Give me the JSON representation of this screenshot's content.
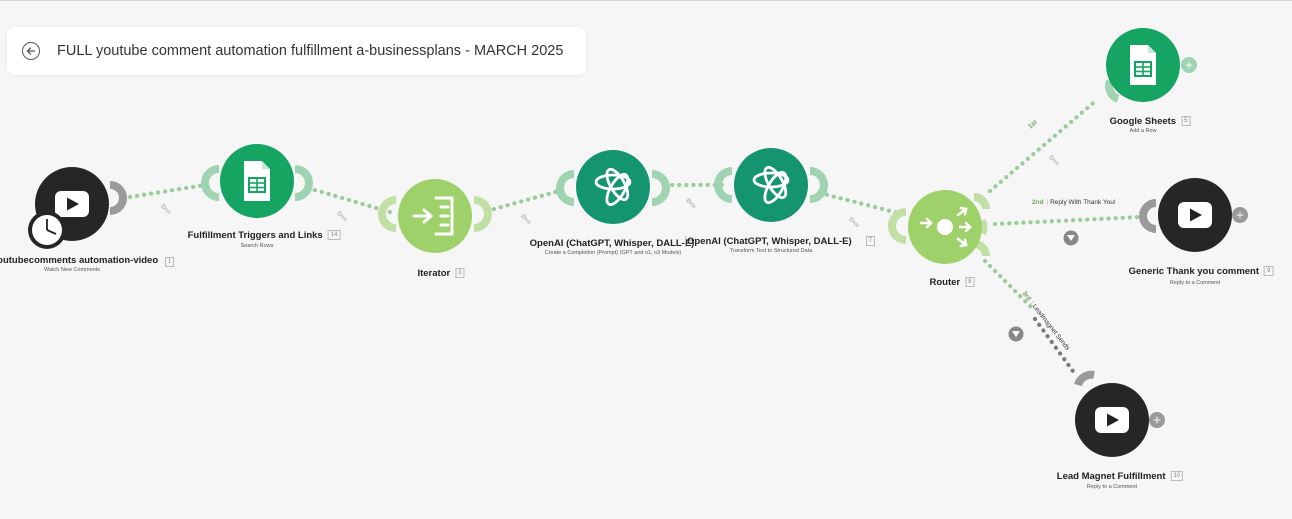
{
  "scenario": {
    "title": "FULL youtube comment automation fulfillment a-businessplans - MARCH 2025",
    "back_icon": "arrow-left-icon"
  },
  "colors": {
    "canvas_bg": "#f6f6f6",
    "youtube": "#262626",
    "sheets": "#15a462",
    "iterator": "#9ed16a",
    "openai": "#14946f",
    "router": "#9ed16a",
    "connector_green": "#98cc98",
    "connector_dark": "#7a7a7a",
    "route_number": "#6da35d"
  },
  "modules": [
    {
      "key": "yt_watch",
      "icon": "youtube-play-icon",
      "name": "youtubecomments automation-video",
      "id": "1",
      "subtitle": "Watch New Comments",
      "trigger_icon": "clock-icon"
    },
    {
      "key": "sheets_search",
      "icon": "google-sheets-icon",
      "name": "Fulfillment Triggers and Links",
      "id": "14",
      "subtitle": "Search Rows"
    },
    {
      "key": "iterator",
      "icon": "iterator-icon",
      "name": "Iterator",
      "id": "3",
      "subtitle": ""
    },
    {
      "key": "openai_1",
      "icon": "openai-icon",
      "name": "OpenAI (ChatGPT, Whisper, DALL-E)",
      "id": "",
      "subtitle": "Create a Completion (Prompt) (GPT and o1, o3 Models)"
    },
    {
      "key": "openai_2",
      "icon": "openai-icon",
      "name": "OpenAI (ChatGPT, Whisper, DALL-E)",
      "id": "7",
      "subtitle": "Transform Text to Structured Data"
    },
    {
      "key": "router",
      "icon": "router-icon",
      "name": "Router",
      "id": "8",
      "subtitle": ""
    },
    {
      "key": "sheets_add",
      "icon": "google-sheets-icon",
      "name": "Google Sheets",
      "id": "5",
      "subtitle": "Add a Row"
    },
    {
      "key": "yt_thanks",
      "icon": "youtube-play-icon",
      "name": "Generic Thank you comment",
      "id": "9",
      "subtitle": "Reply to a Comment"
    },
    {
      "key": "yt_lead",
      "icon": "youtube-play-icon",
      "name": "Lead Magnet Fulfillment",
      "id": "10",
      "subtitle": "Reply to a Comment"
    }
  ],
  "routes": [
    {
      "number": "1st",
      "label": ""
    },
    {
      "number": "2nd",
      "label": "Reply With Thank You!"
    },
    {
      "number": "3rd",
      "label": "Leadmagnet Sends"
    }
  ]
}
